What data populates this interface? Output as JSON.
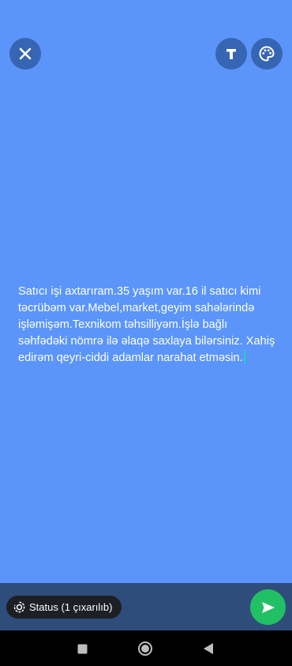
{
  "theme": {
    "background_color": "#5b95f9",
    "bottom_bar_color": "#2f4d7b",
    "send_button_color": "#21c064",
    "cursor_color": "#25d0c0"
  },
  "toolbar": {
    "close_icon": "close-icon",
    "text_icon": "text-icon",
    "palette_icon": "palette-icon"
  },
  "status_text": {
    "body": "Satıcı işi axtarıram.35 yaşım var.16 il satıcı kimi təcrübəm var.Mebel,market,geyim sahələrində işləmişəm.Texnikom təhsilliyəm.İşlə bağlı səhfədəki nömrə ilə əlaqə saxlaya bilərsiniz. Xahiş edirəm qeyri-ciddi adamlar narahat etməsin."
  },
  "bottom_bar": {
    "privacy_label": "Status (1 çıxarılıb)",
    "privacy_icon": "status-privacy-icon",
    "send_icon": "send-icon"
  },
  "nav": {
    "recents_icon": "recents-square-icon",
    "home_icon": "home-circle-icon",
    "back_icon": "back-triangle-icon"
  }
}
